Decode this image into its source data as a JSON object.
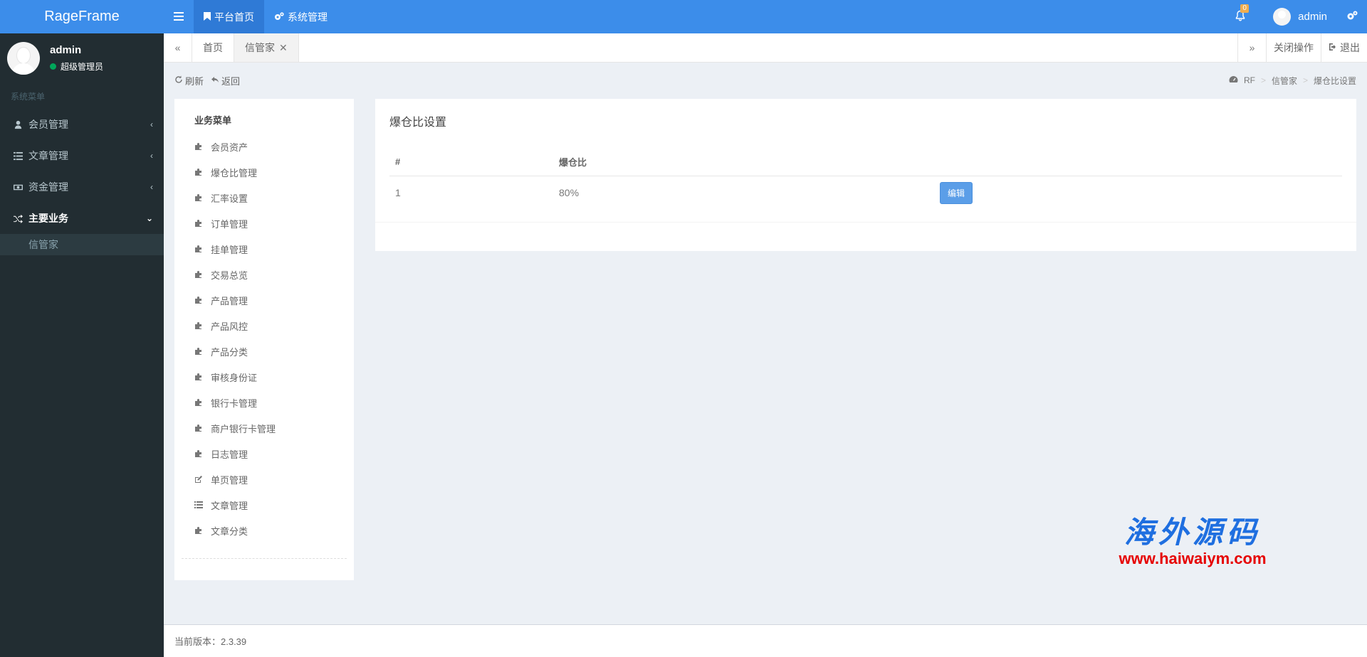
{
  "header": {
    "logo": "RageFrame",
    "menu": [
      {
        "label": "平台首页",
        "icon": "bookmark-icon"
      },
      {
        "label": "系统管理",
        "icon": "gears-icon"
      }
    ],
    "notifications": "0",
    "username": "admin"
  },
  "sidebar": {
    "user": {
      "name": "admin",
      "role": "超级管理员"
    },
    "header": "系统菜单",
    "items": [
      {
        "label": "会员管理",
        "icon": "user-icon"
      },
      {
        "label": "文章管理",
        "icon": "list-icon"
      },
      {
        "label": "资金管理",
        "icon": "money-icon"
      },
      {
        "label": "主要业务",
        "icon": "random-icon"
      }
    ],
    "submenu": [
      "信管家"
    ]
  },
  "tabs": {
    "items": [
      "首页",
      "信管家"
    ],
    "close_ops": "关闭操作",
    "logout": "退出"
  },
  "content_head": {
    "refresh": "刷新",
    "back": "返回",
    "breadcrumb": [
      "RF",
      "信管家",
      "爆仓比设置"
    ]
  },
  "biz_menu": {
    "title": "业务菜单",
    "items": [
      {
        "label": "会员资产",
        "icon": "puzzle-icon"
      },
      {
        "label": "爆仓比管理",
        "icon": "puzzle-icon"
      },
      {
        "label": "汇率设置",
        "icon": "puzzle-icon"
      },
      {
        "label": "订单管理",
        "icon": "puzzle-icon"
      },
      {
        "label": "挂单管理",
        "icon": "puzzle-icon"
      },
      {
        "label": "交易总览",
        "icon": "puzzle-icon"
      },
      {
        "label": "产品管理",
        "icon": "puzzle-icon"
      },
      {
        "label": "产品风控",
        "icon": "puzzle-icon"
      },
      {
        "label": "产品分类",
        "icon": "puzzle-icon"
      },
      {
        "label": "审核身份证",
        "icon": "puzzle-icon"
      },
      {
        "label": "银行卡管理",
        "icon": "puzzle-icon"
      },
      {
        "label": "商户银行卡管理",
        "icon": "puzzle-icon"
      },
      {
        "label": "日志管理",
        "icon": "puzzle-icon"
      },
      {
        "label": "单页管理",
        "icon": "edit-icon"
      },
      {
        "label": "文章管理",
        "icon": "list-icon"
      },
      {
        "label": "文章分类",
        "icon": "puzzle-icon"
      }
    ]
  },
  "main": {
    "title": "爆仓比设置",
    "table": {
      "headers": [
        "#",
        "爆仓比",
        ""
      ],
      "rows": [
        {
          "id": "1",
          "ratio": "80%",
          "action": "编辑"
        }
      ]
    }
  },
  "footer": {
    "version": "当前版本：2.3.39"
  },
  "watermark": {
    "cn": "海外源码",
    "url": "www.haiwaiym.com"
  },
  "colors": {
    "primary": "#3c8dea",
    "sidebar_bg": "#222d32",
    "online": "#00a65a",
    "badge": "#f0ad4e"
  }
}
